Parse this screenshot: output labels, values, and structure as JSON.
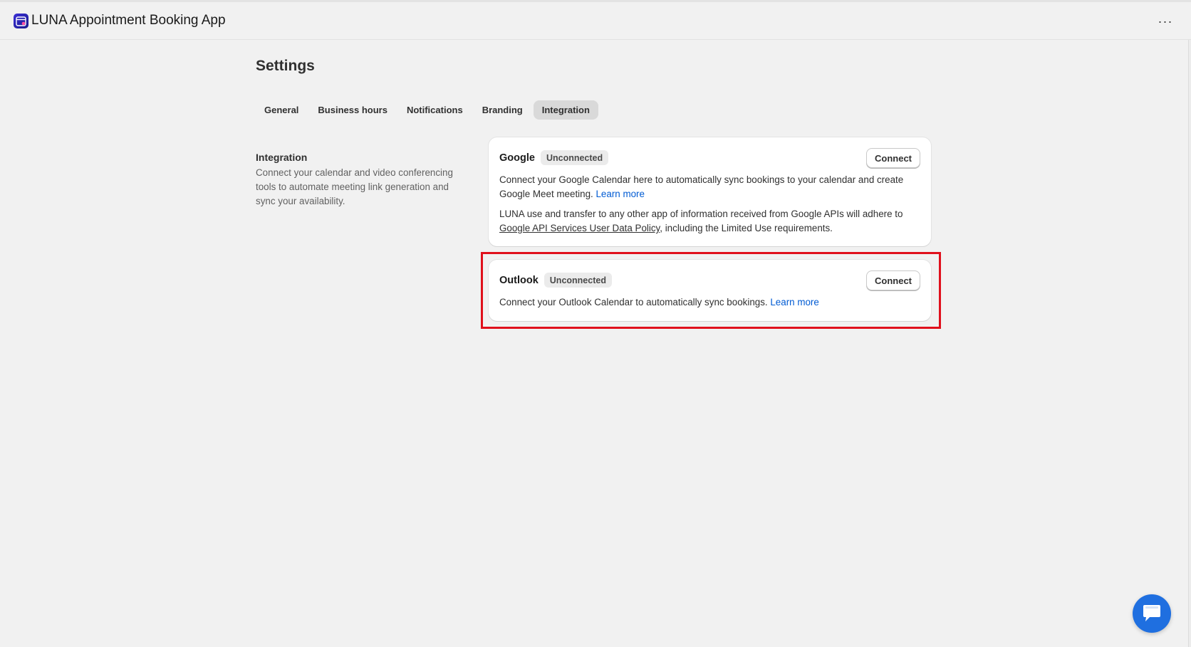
{
  "app": {
    "title": "LUNA Appointment Booking App",
    "more_label": "···"
  },
  "page": {
    "title": "Settings"
  },
  "tabs": [
    {
      "label": "General",
      "active": false
    },
    {
      "label": "Business hours",
      "active": false
    },
    {
      "label": "Notifications",
      "active": false
    },
    {
      "label": "Branding",
      "active": false
    },
    {
      "label": "Integration",
      "active": true
    }
  ],
  "section": {
    "heading": "Integration",
    "description": "Connect your calendar and video conferencing tools to automate meeting link generation and sync your availability."
  },
  "google": {
    "name": "Google",
    "status": "Unconnected",
    "connect_label": "Connect",
    "desc": "Connect your Google Calendar here to automatically sync bookings to your calendar and create Google Meet meeting.",
    "learn_more": "Learn more",
    "policy_prefix": "LUNA use and transfer to any other app of information received from Google APIs will adhere to",
    "policy_link": "Google API Services User Data Policy",
    "policy_suffix": ", including the Limited Use requirements."
  },
  "outlook": {
    "name": "Outlook",
    "status": "Unconnected",
    "connect_label": "Connect",
    "desc": "Connect your Outlook Calendar to automatically sync bookings.",
    "learn_more": "Learn more"
  },
  "colors": {
    "accent_link": "#005bd3",
    "highlight": "#e0101c",
    "chat_button": "#1f6fe0"
  },
  "icons": {
    "app_logo": "calendar-app-logo-icon",
    "more": "more-horizontal-icon",
    "chat": "chat-bubble-icon"
  }
}
